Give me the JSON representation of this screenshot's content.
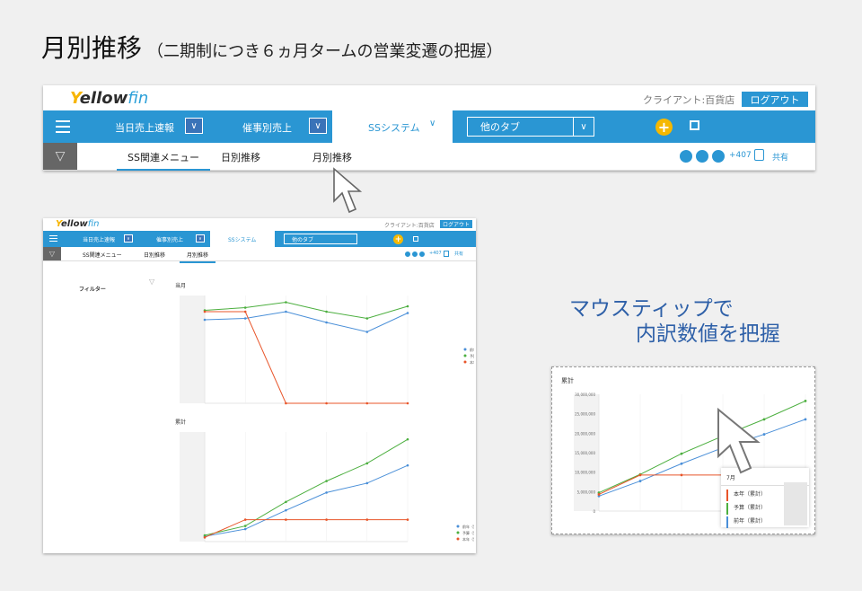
{
  "title": {
    "main": "月別推移",
    "sub": "（二期制につき６ヵ月タームの営業変遷の把握）"
  },
  "callout": {
    "line1": "マウスティップで",
    "line2": "内訳数値を把握"
  },
  "app": {
    "logo": {
      "y": "Y",
      "ellow": "ellow",
      "fin": "fin"
    },
    "client_label": "クライアント:百貨店",
    "logout": "ログアウト",
    "nav": [
      "当日売上速報",
      "催事別売上",
      "SSシステム",
      "他のタブ"
    ],
    "tabs": [
      "SS関連メニュー",
      "日別推移",
      "月別推移"
    ],
    "share_count": "+407",
    "share_label": "共有",
    "filter_label": "フィルター",
    "chart1_title": "当月",
    "chart2_title": "累計"
  },
  "colors": {
    "blue": "#2a96d3",
    "green": "#4caf3f",
    "red": "#e8552a",
    "yellow": "#f5b800"
  },
  "chart_data": [
    {
      "type": "line",
      "title": "当月",
      "series": [
        {
          "name": "前年",
          "color": "#4a8fd8",
          "values": [
            62,
            63,
            68,
            60,
            53,
            67
          ]
        },
        {
          "name": "予算",
          "color": "#4caf3f",
          "values": [
            69,
            71,
            75,
            68,
            63,
            72
          ]
        },
        {
          "name": "本年",
          "color": "#e8552a",
          "values": [
            68,
            68,
            0,
            0,
            0,
            0
          ]
        }
      ],
      "legend": "right"
    },
    {
      "type": "line",
      "title": "累計",
      "series": [
        {
          "name": "前年（累計）",
          "color": "#4a8fd8",
          "values": [
            5,
            12,
            30,
            47,
            56,
            73
          ]
        },
        {
          "name": "予算（累計）",
          "color": "#4caf3f",
          "values": [
            6,
            15,
            38,
            58,
            75,
            98
          ]
        },
        {
          "name": "本年（累計）",
          "color": "#e8552a",
          "values": [
            4,
            21,
            21,
            21,
            21,
            21
          ]
        }
      ],
      "legend": "right"
    },
    {
      "type": "line",
      "title": "累計",
      "yticks": [
        "30,000,000",
        "25,000,000",
        "20,000,000",
        "15,000,000",
        "10,000,000",
        "5,000,000",
        "0"
      ],
      "series": [
        {
          "name": "前年（累計）",
          "color": "#4a8fd8",
          "values": [
            4.5,
            9,
            14.2,
            19,
            23,
            27.5
          ]
        },
        {
          "name": "予算（累計）",
          "color": "#4caf3f",
          "values": [
            5.5,
            11,
            17.2,
            22.5,
            27.5,
            33
          ]
        },
        {
          "name": "本年（累計）",
          "color": "#e8552a",
          "values": [
            5,
            10.8,
            10.8,
            10.8,
            null,
            null
          ]
        }
      ],
      "tooltip": {
        "title": "7月",
        "rows": [
          "本年（累計）",
          "予算（累計）",
          "前年（累計）"
        ]
      }
    }
  ]
}
